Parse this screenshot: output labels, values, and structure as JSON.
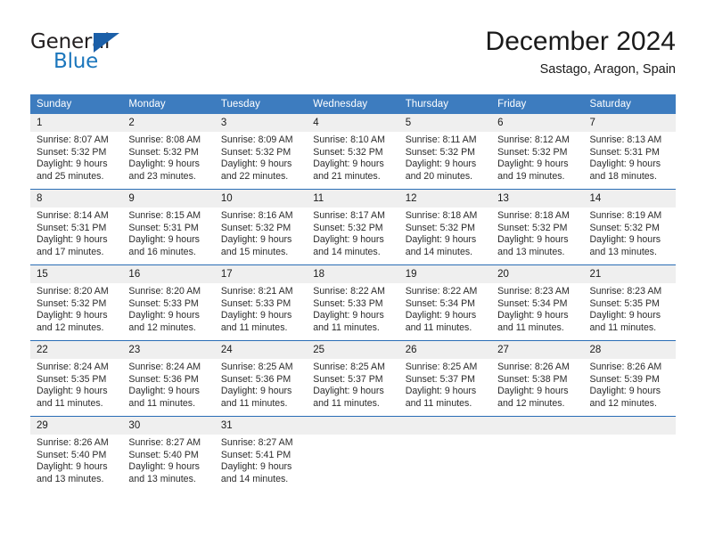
{
  "brand": {
    "name_part1": "General",
    "name_part2": "Blue",
    "triangle_color": "#1b5fa8",
    "blue_color": "#1b76bc"
  },
  "header": {
    "month_title": "December 2024",
    "location": "Sastago, Aragon, Spain"
  },
  "theme": {
    "header_blue": "#3d7cbf",
    "row_divider_blue": "#2a6db5",
    "daynum_band": "#efefef"
  },
  "weekday_headers": [
    "Sunday",
    "Monday",
    "Tuesday",
    "Wednesday",
    "Thursday",
    "Friday",
    "Saturday"
  ],
  "weeks": [
    [
      {
        "day": "1",
        "sunrise": "Sunrise: 8:07 AM",
        "sunset": "Sunset: 5:32 PM",
        "daylight_line1": "Daylight: 9 hours",
        "daylight_line2": "and 25 minutes."
      },
      {
        "day": "2",
        "sunrise": "Sunrise: 8:08 AM",
        "sunset": "Sunset: 5:32 PM",
        "daylight_line1": "Daylight: 9 hours",
        "daylight_line2": "and 23 minutes."
      },
      {
        "day": "3",
        "sunrise": "Sunrise: 8:09 AM",
        "sunset": "Sunset: 5:32 PM",
        "daylight_line1": "Daylight: 9 hours",
        "daylight_line2": "and 22 minutes."
      },
      {
        "day": "4",
        "sunrise": "Sunrise: 8:10 AM",
        "sunset": "Sunset: 5:32 PM",
        "daylight_line1": "Daylight: 9 hours",
        "daylight_line2": "and 21 minutes."
      },
      {
        "day": "5",
        "sunrise": "Sunrise: 8:11 AM",
        "sunset": "Sunset: 5:32 PM",
        "daylight_line1": "Daylight: 9 hours",
        "daylight_line2": "and 20 minutes."
      },
      {
        "day": "6",
        "sunrise": "Sunrise: 8:12 AM",
        "sunset": "Sunset: 5:32 PM",
        "daylight_line1": "Daylight: 9 hours",
        "daylight_line2": "and 19 minutes."
      },
      {
        "day": "7",
        "sunrise": "Sunrise: 8:13 AM",
        "sunset": "Sunset: 5:31 PM",
        "daylight_line1": "Daylight: 9 hours",
        "daylight_line2": "and 18 minutes."
      }
    ],
    [
      {
        "day": "8",
        "sunrise": "Sunrise: 8:14 AM",
        "sunset": "Sunset: 5:31 PM",
        "daylight_line1": "Daylight: 9 hours",
        "daylight_line2": "and 17 minutes."
      },
      {
        "day": "9",
        "sunrise": "Sunrise: 8:15 AM",
        "sunset": "Sunset: 5:31 PM",
        "daylight_line1": "Daylight: 9 hours",
        "daylight_line2": "and 16 minutes."
      },
      {
        "day": "10",
        "sunrise": "Sunrise: 8:16 AM",
        "sunset": "Sunset: 5:32 PM",
        "daylight_line1": "Daylight: 9 hours",
        "daylight_line2": "and 15 minutes."
      },
      {
        "day": "11",
        "sunrise": "Sunrise: 8:17 AM",
        "sunset": "Sunset: 5:32 PM",
        "daylight_line1": "Daylight: 9 hours",
        "daylight_line2": "and 14 minutes."
      },
      {
        "day": "12",
        "sunrise": "Sunrise: 8:18 AM",
        "sunset": "Sunset: 5:32 PM",
        "daylight_line1": "Daylight: 9 hours",
        "daylight_line2": "and 14 minutes."
      },
      {
        "day": "13",
        "sunrise": "Sunrise: 8:18 AM",
        "sunset": "Sunset: 5:32 PM",
        "daylight_line1": "Daylight: 9 hours",
        "daylight_line2": "and 13 minutes."
      },
      {
        "day": "14",
        "sunrise": "Sunrise: 8:19 AM",
        "sunset": "Sunset: 5:32 PM",
        "daylight_line1": "Daylight: 9 hours",
        "daylight_line2": "and 13 minutes."
      }
    ],
    [
      {
        "day": "15",
        "sunrise": "Sunrise: 8:20 AM",
        "sunset": "Sunset: 5:32 PM",
        "daylight_line1": "Daylight: 9 hours",
        "daylight_line2": "and 12 minutes."
      },
      {
        "day": "16",
        "sunrise": "Sunrise: 8:20 AM",
        "sunset": "Sunset: 5:33 PM",
        "daylight_line1": "Daylight: 9 hours",
        "daylight_line2": "and 12 minutes."
      },
      {
        "day": "17",
        "sunrise": "Sunrise: 8:21 AM",
        "sunset": "Sunset: 5:33 PM",
        "daylight_line1": "Daylight: 9 hours",
        "daylight_line2": "and 11 minutes."
      },
      {
        "day": "18",
        "sunrise": "Sunrise: 8:22 AM",
        "sunset": "Sunset: 5:33 PM",
        "daylight_line1": "Daylight: 9 hours",
        "daylight_line2": "and 11 minutes."
      },
      {
        "day": "19",
        "sunrise": "Sunrise: 8:22 AM",
        "sunset": "Sunset: 5:34 PM",
        "daylight_line1": "Daylight: 9 hours",
        "daylight_line2": "and 11 minutes."
      },
      {
        "day": "20",
        "sunrise": "Sunrise: 8:23 AM",
        "sunset": "Sunset: 5:34 PM",
        "daylight_line1": "Daylight: 9 hours",
        "daylight_line2": "and 11 minutes."
      },
      {
        "day": "21",
        "sunrise": "Sunrise: 8:23 AM",
        "sunset": "Sunset: 5:35 PM",
        "daylight_line1": "Daylight: 9 hours",
        "daylight_line2": "and 11 minutes."
      }
    ],
    [
      {
        "day": "22",
        "sunrise": "Sunrise: 8:24 AM",
        "sunset": "Sunset: 5:35 PM",
        "daylight_line1": "Daylight: 9 hours",
        "daylight_line2": "and 11 minutes."
      },
      {
        "day": "23",
        "sunrise": "Sunrise: 8:24 AM",
        "sunset": "Sunset: 5:36 PM",
        "daylight_line1": "Daylight: 9 hours",
        "daylight_line2": "and 11 minutes."
      },
      {
        "day": "24",
        "sunrise": "Sunrise: 8:25 AM",
        "sunset": "Sunset: 5:36 PM",
        "daylight_line1": "Daylight: 9 hours",
        "daylight_line2": "and 11 minutes."
      },
      {
        "day": "25",
        "sunrise": "Sunrise: 8:25 AM",
        "sunset": "Sunset: 5:37 PM",
        "daylight_line1": "Daylight: 9 hours",
        "daylight_line2": "and 11 minutes."
      },
      {
        "day": "26",
        "sunrise": "Sunrise: 8:25 AM",
        "sunset": "Sunset: 5:37 PM",
        "daylight_line1": "Daylight: 9 hours",
        "daylight_line2": "and 11 minutes."
      },
      {
        "day": "27",
        "sunrise": "Sunrise: 8:26 AM",
        "sunset": "Sunset: 5:38 PM",
        "daylight_line1": "Daylight: 9 hours",
        "daylight_line2": "and 12 minutes."
      },
      {
        "day": "28",
        "sunrise": "Sunrise: 8:26 AM",
        "sunset": "Sunset: 5:39 PM",
        "daylight_line1": "Daylight: 9 hours",
        "daylight_line2": "and 12 minutes."
      }
    ],
    [
      {
        "day": "29",
        "sunrise": "Sunrise: 8:26 AM",
        "sunset": "Sunset: 5:40 PM",
        "daylight_line1": "Daylight: 9 hours",
        "daylight_line2": "and 13 minutes."
      },
      {
        "day": "30",
        "sunrise": "Sunrise: 8:27 AM",
        "sunset": "Sunset: 5:40 PM",
        "daylight_line1": "Daylight: 9 hours",
        "daylight_line2": "and 13 minutes."
      },
      {
        "day": "31",
        "sunrise": "Sunrise: 8:27 AM",
        "sunset": "Sunset: 5:41 PM",
        "daylight_line1": "Daylight: 9 hours",
        "daylight_line2": "and 14 minutes."
      },
      {
        "day": "",
        "sunrise": "",
        "sunset": "",
        "daylight_line1": "",
        "daylight_line2": ""
      },
      {
        "day": "",
        "sunrise": "",
        "sunset": "",
        "daylight_line1": "",
        "daylight_line2": ""
      },
      {
        "day": "",
        "sunrise": "",
        "sunset": "",
        "daylight_line1": "",
        "daylight_line2": ""
      },
      {
        "day": "",
        "sunrise": "",
        "sunset": "",
        "daylight_line1": "",
        "daylight_line2": ""
      }
    ]
  ]
}
